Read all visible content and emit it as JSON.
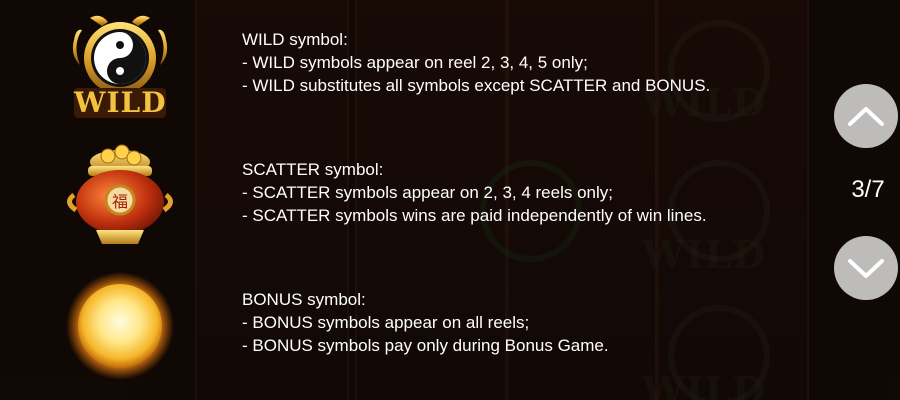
{
  "symbols": [
    {
      "icon": "wild-yin-yang-dragon-icon",
      "icon_text": "WILD",
      "title": "WILD symbol:",
      "lines": [
        "- WILD symbols appear on reel 2, 3, 4, 5 only;",
        "- WILD substitutes all symbols except SCATTER and BONUS."
      ]
    },
    {
      "icon": "scatter-treasure-pot-icon",
      "icon_text": "福",
      "title": "SCATTER symbol:",
      "lines": [
        "- SCATTER symbols appear on 2, 3, 4 reels only;",
        "- SCATTER symbols wins are paid independently of win lines."
      ]
    },
    {
      "icon": "bonus-golden-sun-orb-icon",
      "title": "BONUS symbol:",
      "lines": [
        "- BONUS symbols appear on all reels;",
        "- BONUS symbols pay only during Bonus Game."
      ]
    }
  ],
  "pagination": {
    "current": 3,
    "total": 7,
    "label": "3/7"
  },
  "colors": {
    "text": "#ffffff",
    "gold": "#e8b53a",
    "nav_button": "#dcdcdc"
  }
}
